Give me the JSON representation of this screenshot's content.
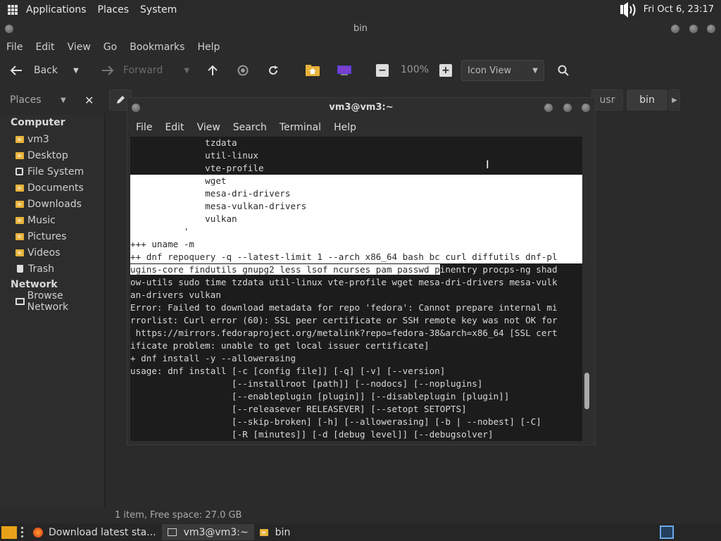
{
  "top_panel": {
    "menus": [
      "Applications",
      "Places",
      "System"
    ],
    "clock": "Fri Oct  6, 23:17",
    "icons": [
      "apps-grid-icon",
      "volume-icon"
    ]
  },
  "file_manager": {
    "title": "bin",
    "menu": [
      "File",
      "Edit",
      "View",
      "Go",
      "Bookmarks",
      "Help"
    ],
    "toolbar": {
      "back": "Back",
      "forward": "Forward",
      "zoom": "100%",
      "view_mode": "Icon View"
    },
    "places_label": "Places",
    "path_buttons": [
      "usr",
      "bin"
    ],
    "sidebar": {
      "computer_label": "Computer",
      "computer_items": [
        "vm3",
        "Desktop",
        "File System",
        "Documents",
        "Downloads",
        "Music",
        "Pictures",
        "Videos",
        "Trash"
      ],
      "network_label": "Network",
      "network_items": [
        "Browse Network"
      ]
    },
    "status": "1 item, Free space: 27.0 GB"
  },
  "terminal": {
    "title": "vm3@vm3:~",
    "menu": [
      "File",
      "Edit",
      "View",
      "Search",
      "Terminal",
      "Help"
    ],
    "lines": [
      "              tzdata",
      "              util-linux",
      "              vte-profile",
      "              wget",
      "              mesa-dri-drivers",
      "              mesa-vulkan-drivers",
      "              vulkan",
      "          '",
      "+++ uname -m",
      "++ dnf repoquery -q --latest-limit 1 --arch x86_64 bash bc curl diffutils dnf-pl",
      "ugins-core findutils gnupg2 less lsof ncurses pam passwd p",
      "inentry procps-ng shad",
      "ow-utils sudo time tzdata util-linux vte-profile wget mesa-dri-drivers mesa-vulk",
      "an-drivers vulkan",
      "Error: Failed to download metadata for repo 'fedora': Cannot prepare internal mi",
      "rrorlist: Curl error (60): SSL peer certificate or SSH remote key was not OK for",
      " https://mirrors.fedoraproject.org/metalink?repo=fedora-38&arch=x86_64 [SSL cert",
      "ificate problem: unable to get local issuer certificate]",
      "+ dnf install -y --allowerasing",
      "usage: dnf install [-c [config file]] [-q] [-v] [--version]",
      "                   [--installroot [path]] [--nodocs] [--noplugins]",
      "                   [--enableplugin [plugin]] [--disableplugin [plugin]]",
      "                   [--releasever RELEASEVER] [--setopt SETOPTS]",
      "                   [--skip-broken] [-h] [--allowerasing] [-b | --nobest] [-C]",
      "                   [-R [minutes]] [-d [debug level]] [--debugsolver]"
    ]
  },
  "taskbar": {
    "tasks": [
      "Download latest sta...",
      "vm3@vm3:~",
      "bin"
    ]
  }
}
